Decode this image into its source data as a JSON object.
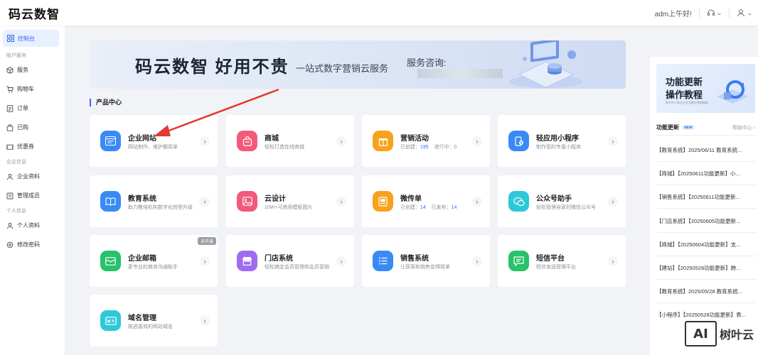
{
  "header": {
    "logo": "码云数智",
    "greeting": "adm上午好!"
  },
  "sidebar": {
    "active": "控制台",
    "groups": [
      {
        "title": "账户服务",
        "items": [
          "服务",
          "购物车",
          "订单",
          "已购",
          "优惠券"
        ]
      },
      {
        "title": "企业信息",
        "items": [
          "企业资料",
          "管理成员"
        ]
      },
      {
        "title": "个人信息",
        "items": [
          "个人资料",
          "修改密码"
        ]
      }
    ]
  },
  "banner": {
    "title": "码云数智  好用不贵",
    "subtitle": "一站式数字营销云服务",
    "consult": "服务咨询:"
  },
  "section_title": "产品中心",
  "cards": [
    {
      "title": "企业网站",
      "desc": "网站制作、维护都简单",
      "icon": "website-icon",
      "color": "#3a8af6"
    },
    {
      "title": "商城",
      "desc": "轻松打造在线商城",
      "icon": "shop-bag-icon",
      "color": "#f25a7a"
    },
    {
      "title": "营销活动",
      "desc_prefix": "已创建：",
      "n1": "195",
      "desc_mid": "进行中：",
      "n2": "0",
      "icon": "gift-icon",
      "color": "#f7a21c"
    },
    {
      "title": "轻应用小程序",
      "desc": "制作您的专属小程序",
      "icon": "miniapp-icon",
      "color": "#3a8af6"
    },
    {
      "title": "教育系统",
      "desc": "助力教培机构数字化转型升级",
      "icon": "book-icon",
      "color": "#3a8af6"
    },
    {
      "title": "云设计",
      "desc": "10W+可商用模板图片",
      "icon": "image-icon",
      "color": "#f25a7a"
    },
    {
      "title": "微传单",
      "desc_prefix": "已创建：",
      "n1": "14",
      "desc_mid": "已发布：",
      "n2": "14",
      "icon": "flyer-icon",
      "color": "#f7a21c"
    },
    {
      "title": "公众号助手",
      "desc": "轻松管理自家的微信公众号",
      "icon": "wechat-icon",
      "color": "#2ec8d8"
    },
    {
      "title": "企业邮箱",
      "desc": "更专业的商务沟通助手",
      "icon": "mail-icon",
      "color": "#27c26a",
      "badge": "未开通"
    },
    {
      "title": "门店系统",
      "desc": "轻松搞定会员管理和会员营销",
      "icon": "store-icon",
      "color": "#9d6cf0"
    },
    {
      "title": "销售系统",
      "desc": "让获客和销售变得简单",
      "icon": "list-icon",
      "color": "#3a8af6"
    },
    {
      "title": "短信平台",
      "desc": "短信发送管理平台",
      "icon": "sms-icon",
      "color": "#27c26a"
    },
    {
      "title": "域名管理",
      "desc": "挑选喜欢的网站域名",
      "icon": "domain-icon",
      "color": "#2ec8d8"
    }
  ],
  "right_panel": {
    "banner_l1": "功能更新",
    "banner_l2": "操作教程",
    "banner_small": "助力中小型企业专业数字营销服务",
    "title": "功能更新",
    "new_badge": "NEW",
    "help": "帮助中心 ›",
    "news": [
      "【教育系统】2025/06/11 教育系统...",
      "【商城】【20250611功能更新】小...",
      "【销售系统】【20250611功能更新...",
      "【门店系统】【20250605功能更新...",
      "【商城】【20250604功能更新】支...",
      "【建站】【20250528功能更新】跨...",
      "【教育系统】2025/05/28 教育系统...",
      "【小程序】【20250528功能更新】表..."
    ]
  },
  "watermark": {
    "box": "AI",
    "text": "树叶云"
  }
}
